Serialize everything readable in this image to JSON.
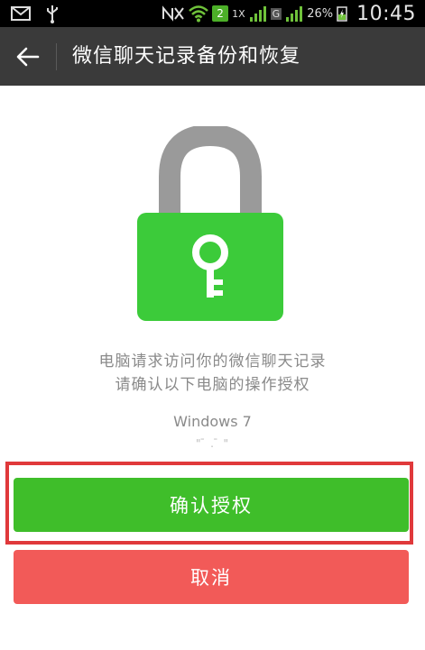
{
  "status_bar": {
    "left_icons": [
      "mail-icon",
      "usb-icon"
    ],
    "sim_number": "2",
    "network_1x": "1X",
    "network_g": "G",
    "battery_percent": "26%",
    "time": "10:45"
  },
  "header": {
    "title": "微信聊天记录备份和恢复"
  },
  "lock": {
    "shackle_color": "#9a9a9a",
    "body_color": "#3ccb3a"
  },
  "message": {
    "line1": "电脑请求访问你的微信聊天记录",
    "line2": "请确认以下电脑的操作授权"
  },
  "device": {
    "name": "Windows 7",
    "detail": "\" ̄ . ̄ \""
  },
  "buttons": {
    "confirm_label": "确认授权",
    "cancel_label": "取消"
  },
  "colors": {
    "confirm": "#3fbe2a",
    "cancel": "#f25a58",
    "highlight_frame": "#e0393b",
    "titlebar": "#3a3a3a"
  }
}
